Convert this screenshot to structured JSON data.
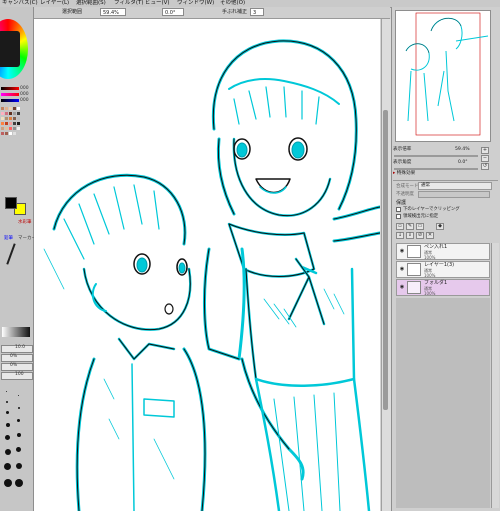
{
  "menubar": {
    "items": [
      "キャンバス(C)",
      "レイヤー(L)",
      "選択範囲(S)",
      "フィルタ(T)",
      "ビュー(V)",
      "ウィンドウ(W)",
      "その他(O)"
    ]
  },
  "toolbar": {
    "selection_label": "選択範囲",
    "zoom_value": "59.4%",
    "rotation_value": "0.0°",
    "stabilizer_label": "手ぶれ補正",
    "stabilizer_value": "3"
  },
  "left_panel": {
    "values": [
      "000",
      "000",
      "000",
      "10.0",
      "0%",
      "0%",
      "100"
    ],
    "brush_label": "水彩筆",
    "marker_label": "マーカー",
    "pen_label": "鉛筆",
    "colors": {
      "foreground": "#000000",
      "background": "#ffff00",
      "accent": "#ff00ff"
    }
  },
  "navigator": {
    "zoom_label": "表示倍率",
    "zoom_value": "59.4%",
    "angle_label": "表示角度",
    "angle_value": "0.0°",
    "flip_label": "特殊効果"
  },
  "layer_panel": {
    "mode_label": "合成モード",
    "mode_value": "通常",
    "opacity_label": "不透明度",
    "protect_label": "保護",
    "clip_label": "下のレイヤーでクリッピング",
    "select_source_label": "領域検出元に指定",
    "layers": [
      {
        "name": "ペン入れ1",
        "mode": "通常",
        "opacity": "100%"
      },
      {
        "name": "レイヤー1(3)",
        "mode": "通常",
        "opacity": "100%"
      },
      {
        "name": "フォルダ1",
        "mode": "通常",
        "opacity": "100%"
      }
    ]
  },
  "colors": {
    "line_cyan": "#00c8d8",
    "line_black": "#111111",
    "selected_layer": "#e6c9ec"
  }
}
